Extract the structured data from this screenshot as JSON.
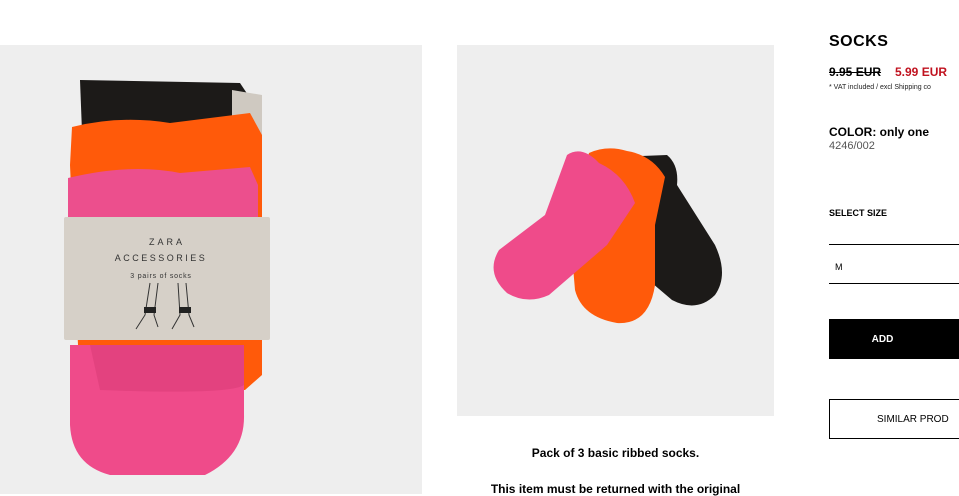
{
  "product": {
    "title": "SOCKS",
    "price_old": "9.95 EUR",
    "price_new": "5.99 EUR",
    "vat_note": "* VAT included / excl Shipping co",
    "color_label": "COLOR: only one",
    "reference": "4246/002",
    "size_label": "SELECT SIZE",
    "size_value": "M",
    "add_label": "ADD",
    "similar_label": "SIMILAR PROD"
  },
  "description": {
    "line1": "Pack of 3 basic ribbed socks.",
    "line2": "This item must be returned with the original"
  },
  "packaging": {
    "brand": "ZARA",
    "subtitle": "ACCESSORIES",
    "content": "3 pairs of socks"
  },
  "colors": {
    "pink": "#ee4a8a",
    "orange": "#ff5a0a",
    "black": "#1c1a18",
    "sale_red": "#c0121f",
    "card": "#d6d0c8"
  }
}
